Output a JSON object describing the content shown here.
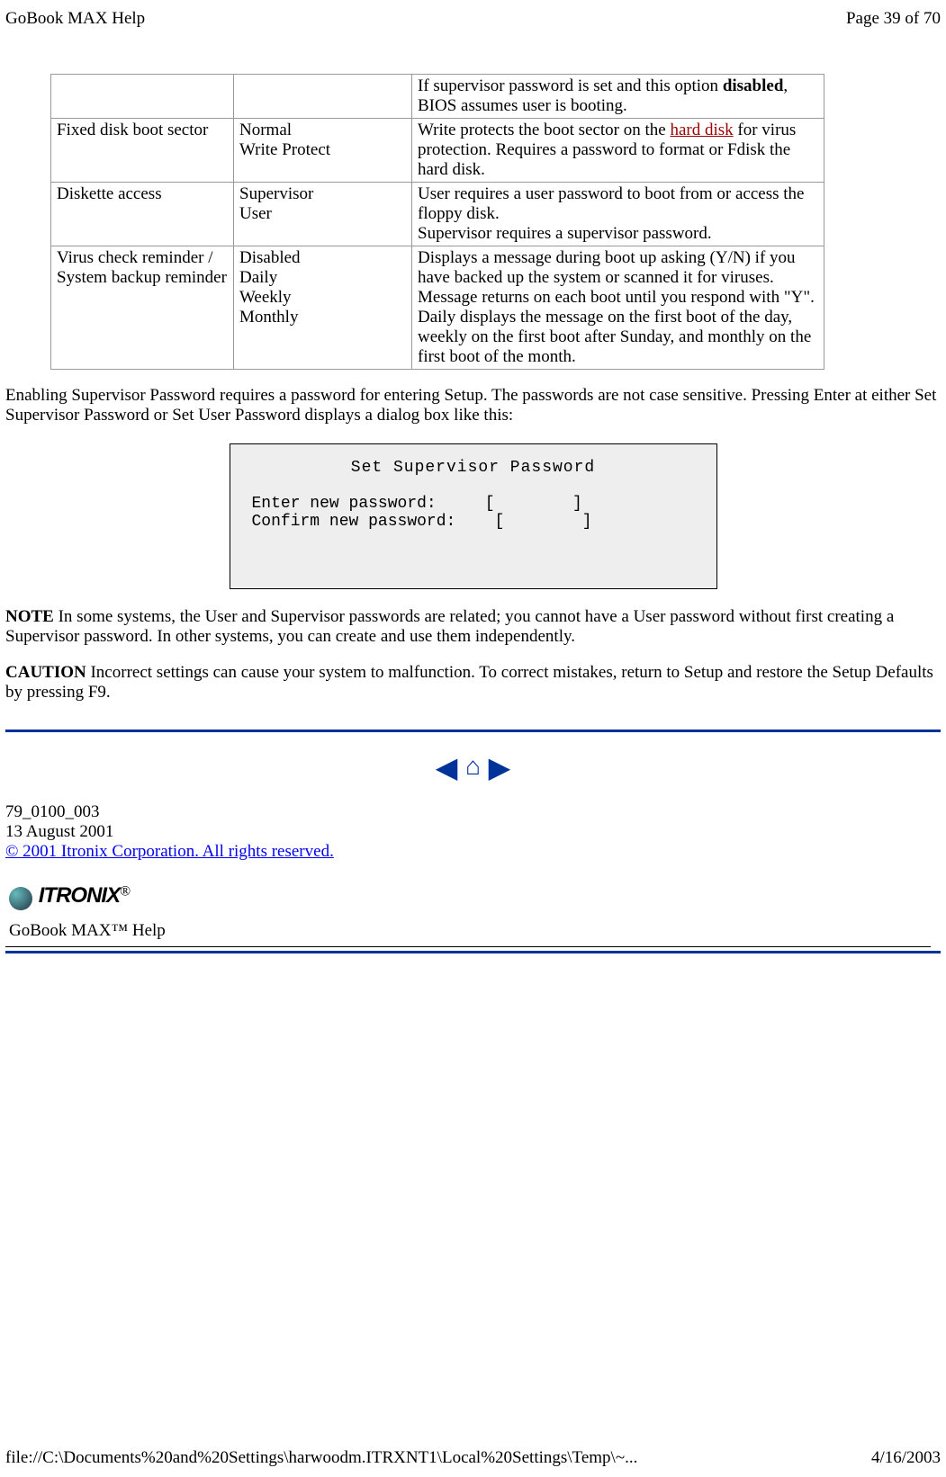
{
  "header": {
    "left": "GoBook MAX Help",
    "right": "Page 39 of 70"
  },
  "table": {
    "row0_desc_l1": "If supervisor password is set and this option ",
    "row0_desc_bold": "disabled",
    "row0_desc_l2": ", BIOS assumes user is booting.",
    "row1_c1": "Fixed disk boot sector",
    "row1_c2_l1": "Normal",
    "row1_c2_l2": "Write Protect",
    "row1_c3_pre": "Write protects the boot sector on the ",
    "row1_c3_link": "hard disk",
    "row1_c3_post": " for virus protection.  Requires a password to format or Fdisk the hard disk.",
    "row2_c1": "Diskette access",
    "row2_c2_l1": "Supervisor",
    "row2_c2_l2": "User",
    "row2_c3_l1": "User requires a user password to boot from or access the floppy disk.",
    "row2_c3_l2": "Supervisor requires a supervisor password.",
    "row3_c1": "Virus check reminder / System backup reminder",
    "row3_c2_l1": "Disabled",
    "row3_c2_l2": "Daily",
    "row3_c2_l3": "Weekly",
    "row3_c2_l4": "Monthly",
    "row3_c3_l1": "Displays a message during boot up asking (Y/N) if you have backed up the system or scanned it for viruses.",
    "row3_c3_l2": "Message returns on each boot until you respond with \"Y\".",
    "row3_c3_l3": "Daily displays the message on the first boot of the day, weekly on the first boot after Sunday, and monthly on the first boot of the month."
  },
  "para1": "Enabling Supervisor Password requires a password for entering Setup.  The passwords are not case sensitive.  Pressing Enter at either Set Supervisor Password or Set User Password displays a dialog box like this:",
  "dialog": {
    "title": "Set Supervisor Password",
    "line1": "Enter new password:     [        ]",
    "line2": "Confirm new password:    [        ]"
  },
  "note_label": "NOTE",
  "note_text": "  In some systems, the User and Supervisor passwords are related; you cannot have a User password without first creating a Supervisor password.  In other systems, you can create and use them independently.",
  "caution_label": "CAUTION",
  "caution_text": "  Incorrect settings can cause your system to malfunction.  To correct mistakes, return to Setup and restore the Setup Defaults by pressing F9.",
  "docinfo": {
    "docnum": "79_0100_003",
    "date": "13 August 2001",
    "copyright": "© 2001 Itronix Corporation.  All rights reserved."
  },
  "logo_text": "ITRONIX",
  "logo_r": "®",
  "product_help": "GoBook MAX™ Help",
  "footer": {
    "left": "file://C:\\Documents%20and%20Settings\\harwoodm.ITRXNT1\\Local%20Settings\\Temp\\~...",
    "right": "4/16/2003"
  }
}
